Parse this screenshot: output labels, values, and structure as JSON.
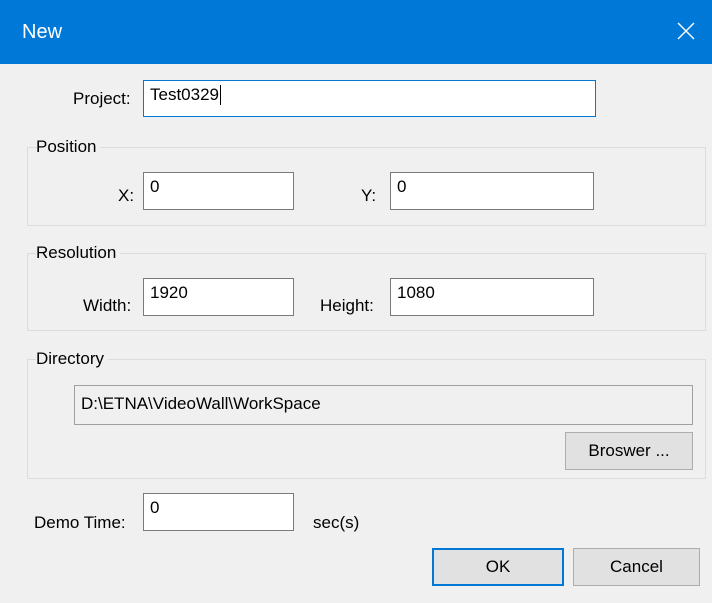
{
  "window": {
    "title": "New"
  },
  "project": {
    "label": "Project:",
    "value": "Test0329"
  },
  "position": {
    "group_title": "Position",
    "x_label": "X:",
    "x_value": "0",
    "y_label": "Y:",
    "y_value": "0"
  },
  "resolution": {
    "group_title": "Resolution",
    "width_label": "Width:",
    "width_value": "1920",
    "height_label": "Height:",
    "height_value": "1080"
  },
  "directory": {
    "group_title": "Directory",
    "path": "D:\\ETNA\\VideoWall\\WorkSpace",
    "browse_label": "Broswer ..."
  },
  "demo_time": {
    "label": "Demo Time:",
    "value": "0",
    "unit": "sec(s)"
  },
  "buttons": {
    "ok_label": "OK",
    "cancel_label": "Cancel"
  },
  "colors": {
    "titlebar": "#0078d7",
    "dialog_bg": "#f0f0f0",
    "focus_border": "#0078d7"
  },
  "icons": {
    "close": "close-icon"
  }
}
